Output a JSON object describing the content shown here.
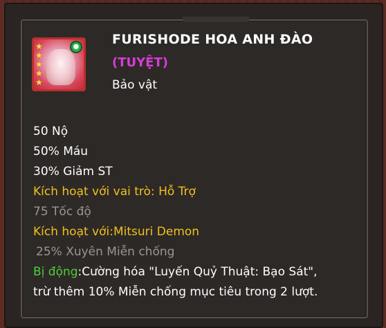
{
  "item": {
    "title": "FURISHODE HOA ANH ĐÀO",
    "rarity": "(TUYỆT)",
    "category": "Bảo vật",
    "stars": 5,
    "badge_icon": "element-orb-icon"
  },
  "stats": {
    "line1": "50 Nộ",
    "line2": "50% Máu",
    "line3": "30% Giảm ST",
    "activate_role": "Kích hoạt với vai trò: Hỗ Trợ",
    "role_bonus": "75 Tốc độ",
    "activate_char": "Kích hoạt với:Mitsuri Demon",
    "char_bonus": "25% Xuyên Miễn chống"
  },
  "passive": {
    "label": "Bị động",
    "text1": ":Cường hóa \"Luyến Quỷ Thuật: Bạo Sát\",",
    "text2": "trừ thêm 10% Miễn chống mục tiêu trong 2 lượt."
  },
  "colors": {
    "title": "#ffffff",
    "rarity": "#d83cd8",
    "activation": "#f2c01c",
    "inactive": "#9a9696",
    "passive_label": "#4ccf3a"
  }
}
